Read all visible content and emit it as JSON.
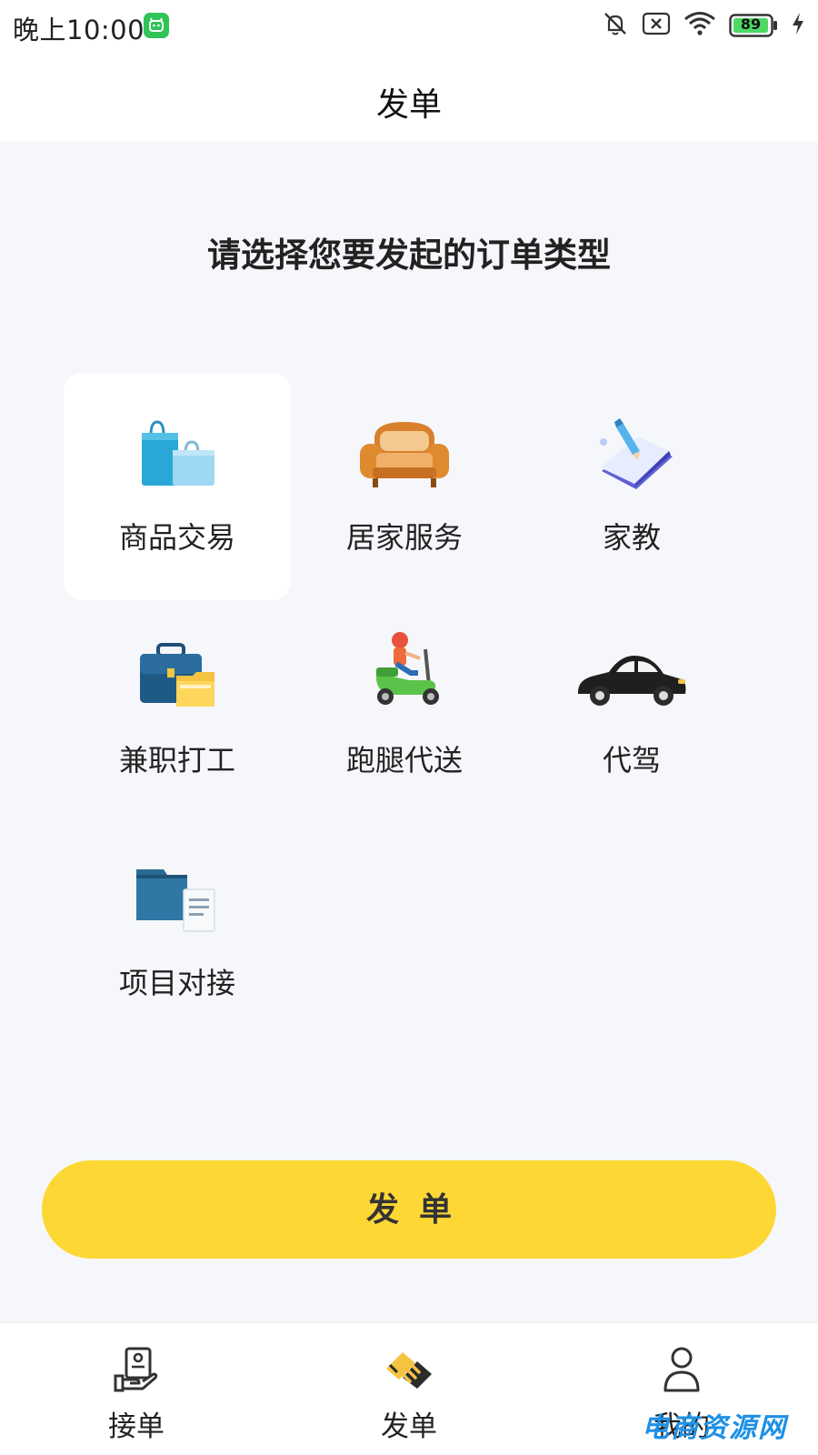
{
  "status_bar": {
    "time": "晚上10:00",
    "battery": "89",
    "icons": [
      "app-notification-icon",
      "mute-icon",
      "no-sim-icon",
      "wifi-icon",
      "battery-icon",
      "charging-icon"
    ]
  },
  "header": {
    "title": "发单"
  },
  "prompt": "请选择您要发起的订单类型",
  "order_types": [
    {
      "label": "商品交易",
      "icon": "shopping-bag-icon",
      "selected": true
    },
    {
      "label": "居家服务",
      "icon": "sofa-icon",
      "selected": false
    },
    {
      "label": "家教",
      "icon": "book-pen-icon",
      "selected": false
    },
    {
      "label": "兼职打工",
      "icon": "briefcase-icon",
      "selected": false
    },
    {
      "label": "跑腿代送",
      "icon": "scooter-courier-icon",
      "selected": false
    },
    {
      "label": "代驾",
      "icon": "car-icon",
      "selected": false
    },
    {
      "label": "项目对接",
      "icon": "folder-document-icon",
      "selected": false
    }
  ],
  "submit_label": "发单",
  "bottom_nav": [
    {
      "label": "接单",
      "icon": "receive-order-icon",
      "active": false
    },
    {
      "label": "发单",
      "icon": "handshake-icon",
      "active": true
    },
    {
      "label": "我的",
      "icon": "profile-icon",
      "active": false
    }
  ],
  "watermark": "电商资源网",
  "colors": {
    "accent": "#fdd835",
    "background": "#f6f7fb",
    "card": "#ffffff"
  }
}
